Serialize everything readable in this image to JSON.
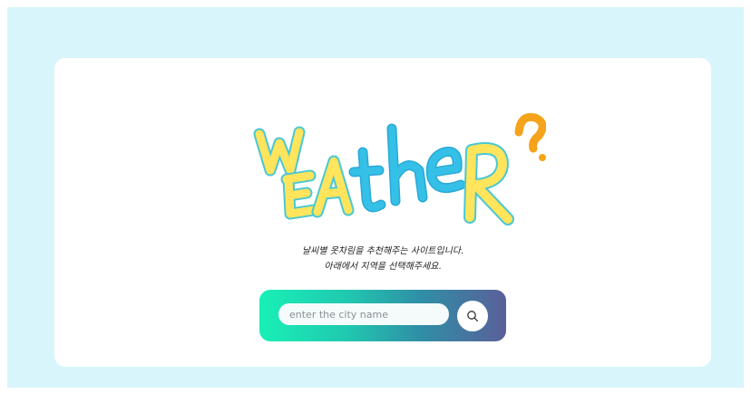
{
  "logo": {
    "letters": [
      "W",
      "E",
      "A",
      "t",
      "h",
      "e",
      "R",
      "?"
    ],
    "colors": {
      "yellow": "#ffe45c",
      "blue": "#35c0e8",
      "orange": "#f5a31a",
      "outline": "#49c8d4"
    }
  },
  "description": {
    "line1": "날씨별 옷차림을 추천해주는 사이트입니다.",
    "line2": "아래에서 지역을 선택해주세요."
  },
  "search": {
    "placeholder": "enter the city name",
    "button_icon": "search-icon"
  },
  "colors": {
    "background": "#d8f5fb",
    "card": "#ffffff",
    "gradient_start": "#19f0b6",
    "gradient_end": "#5a5f9a"
  }
}
